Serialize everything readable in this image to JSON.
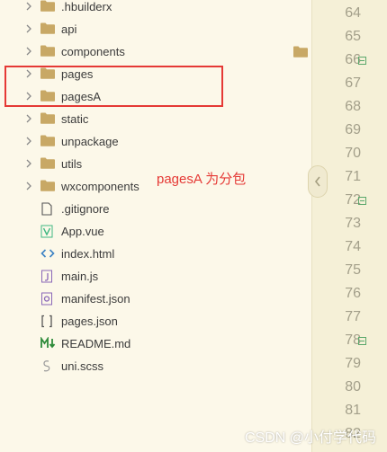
{
  "explorer": {
    "items": [
      {
        "label": ".hbuilderx",
        "type": "folder"
      },
      {
        "label": "api",
        "type": "folder"
      },
      {
        "label": "components",
        "type": "folder"
      },
      {
        "label": "pages",
        "type": "folder"
      },
      {
        "label": "pagesA",
        "type": "folder"
      },
      {
        "label": "static",
        "type": "folder"
      },
      {
        "label": "unpackage",
        "type": "folder"
      },
      {
        "label": "utils",
        "type": "folder"
      },
      {
        "label": "wxcomponents",
        "type": "folder"
      },
      {
        "label": ".gitignore",
        "type": "file",
        "icon": "file-icon"
      },
      {
        "label": "App.vue",
        "type": "file",
        "icon": "vue-icon"
      },
      {
        "label": "index.html",
        "type": "file",
        "icon": "html-icon"
      },
      {
        "label": "main.js",
        "type": "file",
        "icon": "js-icon"
      },
      {
        "label": "manifest.json",
        "type": "file",
        "icon": "manifest-icon"
      },
      {
        "label": "pages.json",
        "type": "file",
        "icon": "json-icon"
      },
      {
        "label": "README.md",
        "type": "file",
        "icon": "markdown-icon"
      },
      {
        "label": "uni.scss",
        "type": "file",
        "icon": "scss-icon"
      }
    ]
  },
  "annotation": {
    "text": "pagesA 为分包"
  },
  "gutter": {
    "line_numbers": [
      "64",
      "65",
      "66",
      "67",
      "68",
      "69",
      "70",
      "71",
      "72",
      "73",
      "74",
      "75",
      "76",
      "77",
      "78",
      "79",
      "80",
      "81",
      "82"
    ],
    "fold_markers_at": [
      "66",
      "72",
      "78"
    ]
  },
  "watermark": "CSDN @小付学代码",
  "colors": {
    "folder": "#c8a865",
    "highlight_box": "#e53935",
    "annotation": "#e53935",
    "fold_marker": "#5aa86b",
    "vue": "#41b883",
    "html": "#3b82c4",
    "markdown": "#2e8b3a"
  }
}
